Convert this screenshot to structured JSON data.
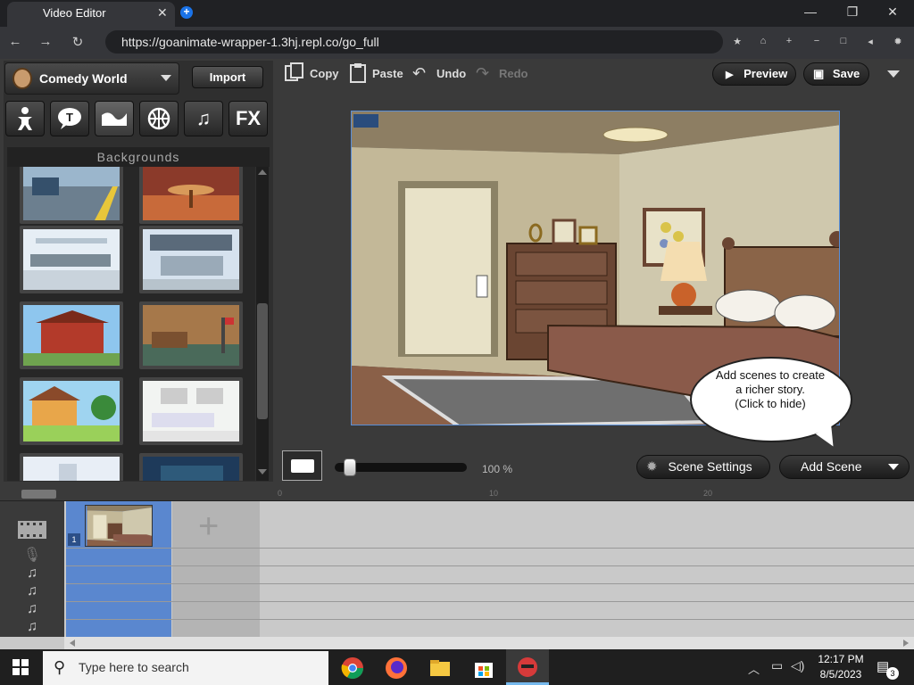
{
  "browser": {
    "tab_title": "Video Editor",
    "url": "https://goanimate-wrapper-1.3hj.repl.co/go_full"
  },
  "editor": {
    "theme_label": "Comedy World",
    "import_label": "Import",
    "categories": [
      "FX"
    ],
    "panel_header": "Backgrounds",
    "toolbar": {
      "copy": "Copy",
      "paste": "Paste",
      "undo": "Undo",
      "redo": "Redo",
      "preview": "Preview",
      "save": "Save"
    },
    "bubble_text": "Add scenes to create a richer story.\n(Click to hide)",
    "zoom_label": "100 %",
    "scene_settings": "Scene Settings",
    "add_scene": "Add Scene",
    "timeline": {
      "scene_number": "1",
      "ticks": [
        "0",
        "10",
        "20"
      ]
    }
  },
  "taskbar": {
    "search_placeholder": "Type here to search",
    "time": "12:17 PM",
    "date": "8/5/2023",
    "notifications": "3"
  },
  "colors": {
    "accent_blue": "#5a87cf",
    "stage_border": "#5a8fd8"
  }
}
